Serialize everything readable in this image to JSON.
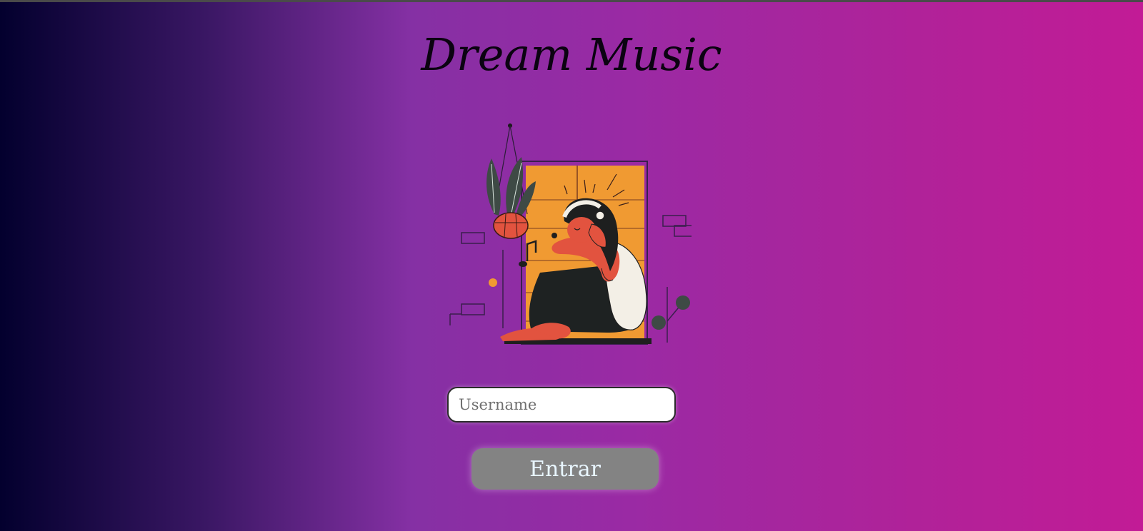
{
  "app": {
    "title": "Dream Music"
  },
  "illustration": {
    "icon": "girl-listening-music-illustration"
  },
  "login": {
    "username_placeholder": "Username",
    "username_value": "",
    "submit_label": "Entrar"
  },
  "colors": {
    "gradient_start": "#03002e",
    "gradient_mid": "#8530a4",
    "gradient_end": "#c21b96",
    "button_bg": "#838383",
    "window_orange": "#f09a32"
  }
}
